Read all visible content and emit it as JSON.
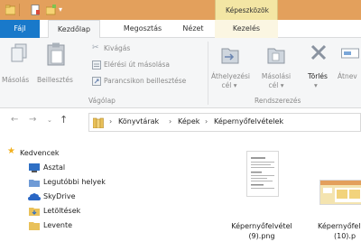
{
  "ribbon_tabs": {
    "context_group": "Képeszközök",
    "file": "Fájl",
    "home": "Kezdőlap",
    "share": "Megosztás",
    "view": "Nézet",
    "manage": "Kezelés"
  },
  "ribbon": {
    "copy": "Másolás",
    "paste": "Beillesztés",
    "cut": "Kivágás",
    "copy_path": "Elérési út másolása",
    "paste_shortcut": "Parancsikon beillesztése",
    "clipboard_group": "Vágólap",
    "move_to": [
      "Áthelyezési",
      "cél ▾"
    ],
    "copy_to": [
      "Másolási",
      "cél ▾"
    ],
    "delete": [
      "Törlés",
      "▾"
    ],
    "rename": "Átnev",
    "organize_group": "Rendszerezés"
  },
  "address": {
    "crumbs": [
      "Könyvtárak",
      "Képek",
      "Képernyőfelvételek"
    ],
    "separator": "›"
  },
  "nav": {
    "favorites": "Kedvencek",
    "items": [
      "Asztal",
      "Legutóbbi helyek",
      "SkyDrive",
      "Letöltések",
      "Levente"
    ]
  },
  "files": [
    {
      "name_line1": "Képernyőfelvétel",
      "name_line2": "(9).png"
    },
    {
      "name_line1": "Képernyőfelv",
      "name_line2": "(10).p"
    }
  ],
  "colors": {
    "titlebar": "#e3a05c",
    "file_tab": "#1979ca",
    "context_tab": "#f3e6a4",
    "favorites_star": "#f2b01e",
    "folder": "#e9c15a"
  }
}
